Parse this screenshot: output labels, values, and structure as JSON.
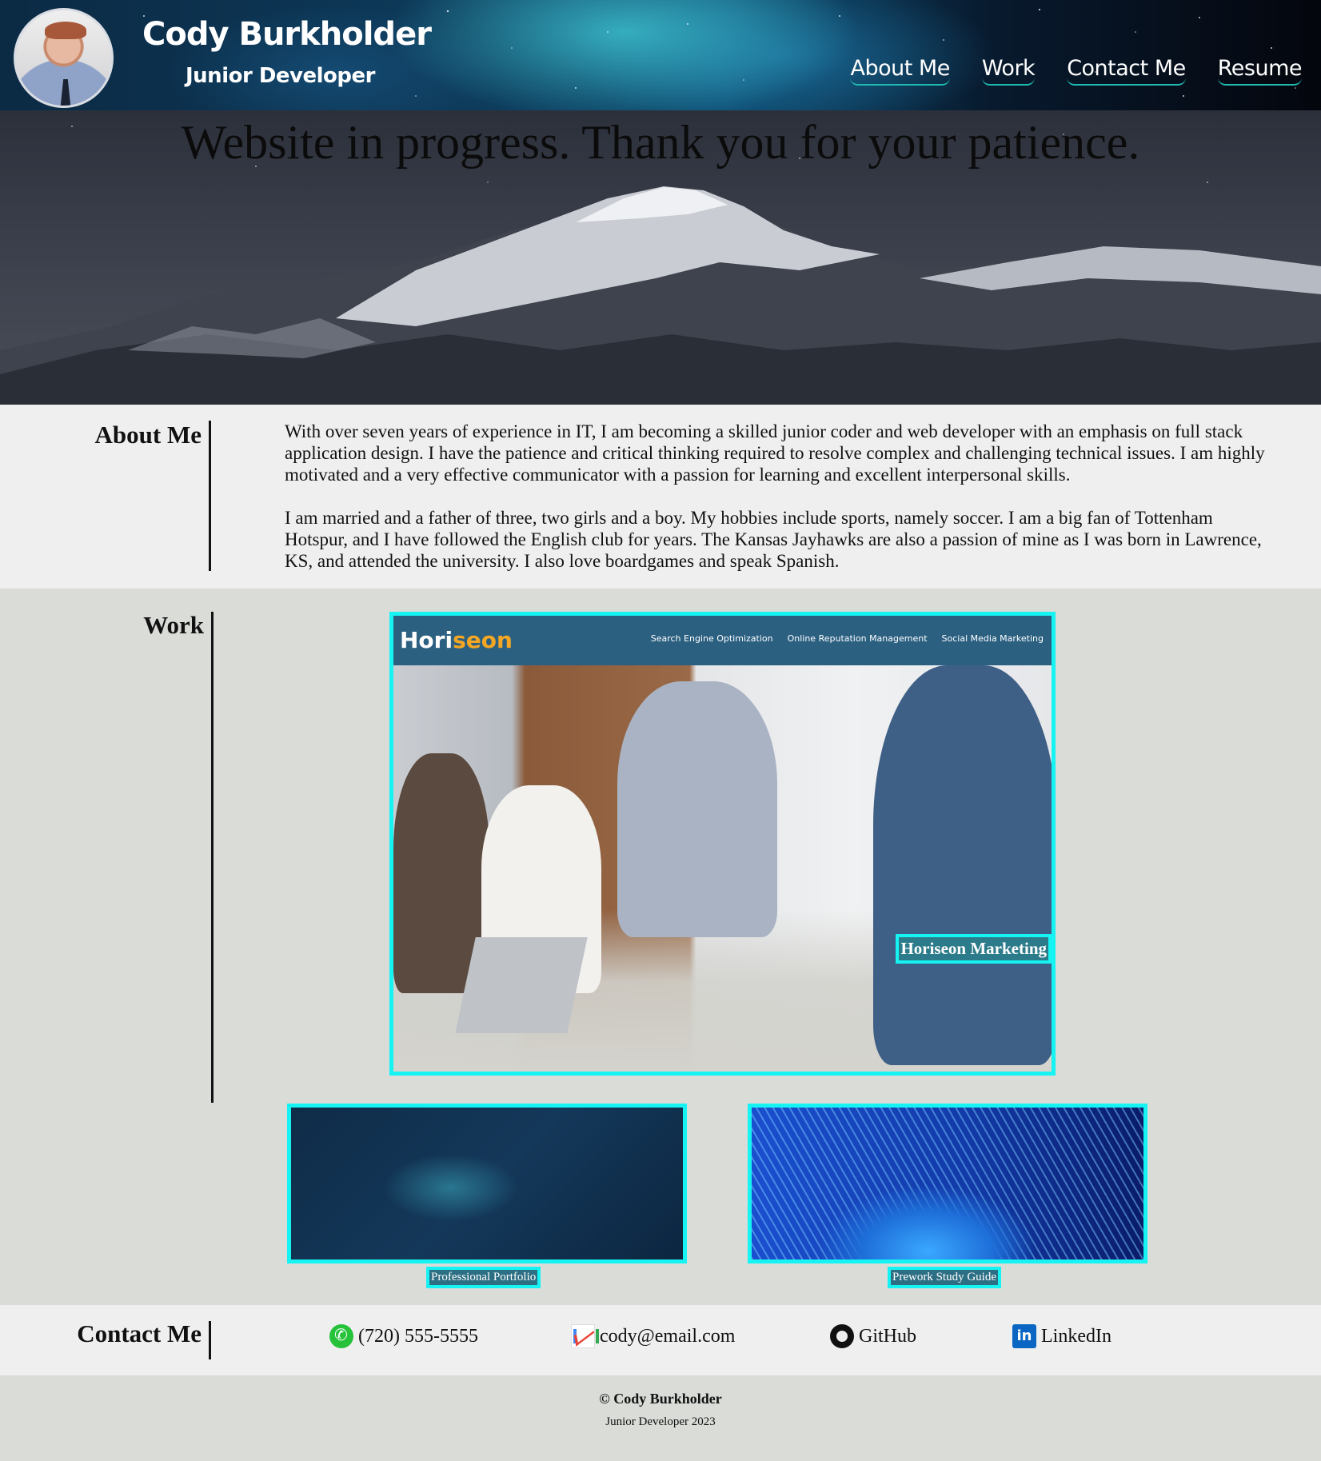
{
  "header": {
    "name": "Cody Burkholder",
    "role": "Junior Developer",
    "nav": [
      {
        "label": "About Me"
      },
      {
        "label": "Work"
      },
      {
        "label": "Contact Me"
      },
      {
        "label": "Resume"
      }
    ]
  },
  "hero": {
    "message": "Website in progress. Thank you for your patience."
  },
  "about": {
    "title": "About Me",
    "paragraphs": [
      "With over seven years of experience in IT, I am becoming a skilled junior coder and web developer with an emphasis on full stack application design. I have the patience and critical thinking required to resolve complex and challenging technical issues. I am highly motivated and a very effective communicator with a passion for learning and excellent interpersonal skills.",
      "I am married and a father of three, two girls and a boy. My hobbies include sports, namely soccer. I am a big fan of Tottenham Hotspur, and I have followed the English club for years. The Kansas Jayhawks are also a passion of mine as I was born in Lawrence, KS, and attended the university. I also love boardgames and speak Spanish."
    ]
  },
  "work": {
    "title": "Work",
    "featured": {
      "caption": "Horiseon Marketing",
      "logo_main": "Hori",
      "logo_accent": "seon",
      "links": [
        "Search Engine Optimization",
        "Online Reputation Management",
        "Social Media Marketing"
      ]
    },
    "projects": [
      {
        "caption": "Professional Portfolio"
      },
      {
        "caption": "Prework Study Guide"
      }
    ]
  },
  "contact": {
    "title": "Contact Me",
    "phone": "(720) 555-5555",
    "email": "cody@email.com",
    "github": "GitHub",
    "linkedin": "LinkedIn",
    "icons": {
      "phone": "phone-icon",
      "email": "gmail-icon",
      "github": "github-icon",
      "linkedin": "linkedin-icon"
    }
  },
  "footer": {
    "copyright": "© Cody Burkholder",
    "subtitle": "Junior Developer 2023"
  },
  "colors": {
    "accent_border": "#15f3f3",
    "nav_underline": "#1fb9b0",
    "horiseon_nav": "#2b6081",
    "horiseon_accent": "#f5a623"
  }
}
